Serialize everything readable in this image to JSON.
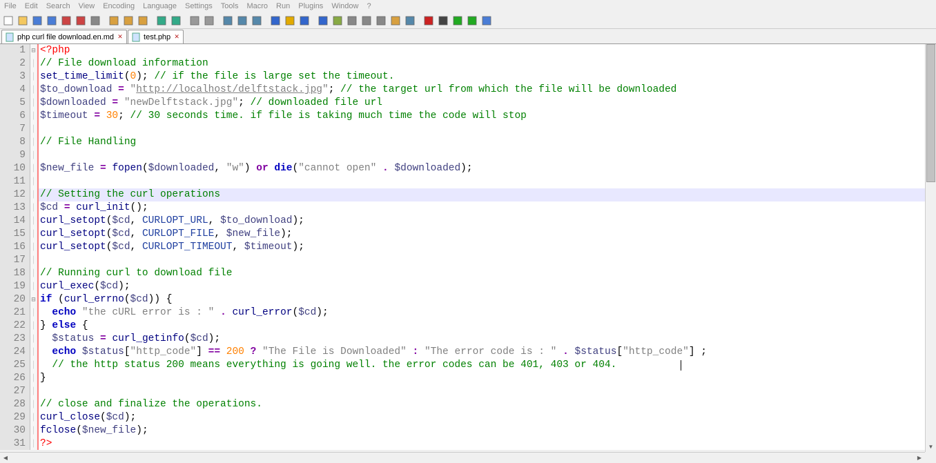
{
  "menu": [
    "File",
    "Edit",
    "Search",
    "View",
    "Encoding",
    "Language",
    "Settings",
    "Tools",
    "Macro",
    "Run",
    "Plugins",
    "Window",
    "?"
  ],
  "toolbar_icons": [
    "new-icon",
    "open-icon",
    "save-icon",
    "saveall-icon",
    "close-icon",
    "closeall-icon",
    "print-icon",
    "",
    "cut-icon",
    "copy-icon",
    "paste-icon",
    "",
    "undo-icon",
    "redo-icon",
    "",
    "find-icon",
    "replace-icon",
    "",
    "zoomin-icon",
    "zoomout-icon",
    "sync-icon",
    "",
    "wordwrap-icon",
    "showall-icon",
    "indent-icon",
    "",
    "foldlevel-icon",
    "userlang-icon",
    "doc-map-icon",
    "doc-list-icon",
    "func-list-icon",
    "folder-icon",
    "monitor-icon",
    "",
    "record-icon",
    "stop-icon",
    "play-icon",
    "playmulti-icon",
    "savemacro-icon"
  ],
  "tabs": [
    {
      "label": "php curl file download.en.md",
      "active": false
    },
    {
      "label": "test.php",
      "active": true
    }
  ],
  "highlight_line": 12,
  "fold_marks": {
    "1": "⊟",
    "20": "⊟"
  },
  "cursor_line": 25,
  "lines": [
    {
      "n": 1,
      "seg": [
        [
          "<?php",
          "c-tag"
        ]
      ]
    },
    {
      "n": 2,
      "seg": [
        [
          "// File download information",
          "c-cmt"
        ]
      ]
    },
    {
      "n": 3,
      "seg": [
        [
          "set_time_limit",
          "c-fn"
        ],
        [
          "(",
          ""
        ],
        [
          "0",
          "c-num"
        ],
        [
          ");",
          ""
        ],
        [
          " ",
          ""
        ],
        [
          "// if the file is large set the timeout.",
          "c-cmt"
        ]
      ]
    },
    {
      "n": 4,
      "seg": [
        [
          "$to_download",
          "c-vr"
        ],
        [
          " ",
          ""
        ],
        [
          "=",
          "c-op"
        ],
        [
          " ",
          ""
        ],
        [
          "\"",
          "c-str"
        ],
        [
          "http://localhost/delftstack.jpg",
          "c-url"
        ],
        [
          "\"",
          "c-str"
        ],
        [
          "; ",
          ""
        ],
        [
          "// the target url from which the file will be downloaded",
          "c-cmt"
        ]
      ]
    },
    {
      "n": 5,
      "seg": [
        [
          "$downloaded",
          "c-vr"
        ],
        [
          " ",
          ""
        ],
        [
          "=",
          "c-op"
        ],
        [
          " ",
          ""
        ],
        [
          "\"newDelftstack.jpg\"",
          "c-str"
        ],
        [
          "; ",
          ""
        ],
        [
          "// downloaded file url",
          "c-cmt"
        ]
      ]
    },
    {
      "n": 6,
      "seg": [
        [
          "$timeout",
          "c-vr"
        ],
        [
          " ",
          ""
        ],
        [
          "=",
          "c-op"
        ],
        [
          " ",
          ""
        ],
        [
          "30",
          "c-num"
        ],
        [
          "; ",
          ""
        ],
        [
          "// 30 seconds time. if file is taking much time the code will stop",
          "c-cmt"
        ]
      ]
    },
    {
      "n": 7,
      "seg": [
        [
          "",
          ""
        ]
      ]
    },
    {
      "n": 8,
      "seg": [
        [
          "// File Handling",
          "c-cmt"
        ]
      ]
    },
    {
      "n": 9,
      "seg": [
        [
          "",
          ""
        ]
      ]
    },
    {
      "n": 10,
      "seg": [
        [
          "$new_file",
          "c-vr"
        ],
        [
          " ",
          ""
        ],
        [
          "=",
          "c-op"
        ],
        [
          " ",
          ""
        ],
        [
          "fopen",
          "c-fn"
        ],
        [
          "(",
          ""
        ],
        [
          "$downloaded",
          "c-vr"
        ],
        [
          ", ",
          ""
        ],
        [
          "\"w\"",
          "c-str"
        ],
        [
          ") ",
          ""
        ],
        [
          "or",
          "c-kw2"
        ],
        [
          " ",
          ""
        ],
        [
          "die",
          "c-kw"
        ],
        [
          "(",
          ""
        ],
        [
          "\"cannot open\"",
          "c-str"
        ],
        [
          " ",
          ""
        ],
        [
          ".",
          "c-op"
        ],
        [
          " ",
          ""
        ],
        [
          "$downloaded",
          "c-vr"
        ],
        [
          ");",
          ""
        ]
      ]
    },
    {
      "n": 11,
      "seg": [
        [
          "",
          ""
        ]
      ]
    },
    {
      "n": 12,
      "seg": [
        [
          "// Setting the curl operations",
          "c-cmt"
        ]
      ]
    },
    {
      "n": 13,
      "seg": [
        [
          "$cd",
          "c-vr"
        ],
        [
          " ",
          ""
        ],
        [
          "=",
          "c-op"
        ],
        [
          " ",
          ""
        ],
        [
          "curl_init",
          "c-fn"
        ],
        [
          "();",
          ""
        ]
      ]
    },
    {
      "n": 14,
      "seg": [
        [
          "curl_setopt",
          "c-fn"
        ],
        [
          "(",
          ""
        ],
        [
          "$cd",
          "c-vr"
        ],
        [
          ", ",
          ""
        ],
        [
          "CURLOPT_URL",
          "c-con"
        ],
        [
          ", ",
          ""
        ],
        [
          "$to_download",
          "c-vr"
        ],
        [
          ");",
          ""
        ]
      ]
    },
    {
      "n": 15,
      "seg": [
        [
          "curl_setopt",
          "c-fn"
        ],
        [
          "(",
          ""
        ],
        [
          "$cd",
          "c-vr"
        ],
        [
          ", ",
          ""
        ],
        [
          "CURLOPT_FILE",
          "c-con"
        ],
        [
          ", ",
          ""
        ],
        [
          "$new_file",
          "c-vr"
        ],
        [
          ");",
          ""
        ]
      ]
    },
    {
      "n": 16,
      "seg": [
        [
          "curl_setopt",
          "c-fn"
        ],
        [
          "(",
          ""
        ],
        [
          "$cd",
          "c-vr"
        ],
        [
          ", ",
          ""
        ],
        [
          "CURLOPT_TIMEOUT",
          "c-con"
        ],
        [
          ", ",
          ""
        ],
        [
          "$timeout",
          "c-vr"
        ],
        [
          ");",
          ""
        ]
      ]
    },
    {
      "n": 17,
      "seg": [
        [
          "",
          ""
        ]
      ]
    },
    {
      "n": 18,
      "seg": [
        [
          "// Running curl to download file",
          "c-cmt"
        ]
      ]
    },
    {
      "n": 19,
      "seg": [
        [
          "curl_exec",
          "c-fn"
        ],
        [
          "(",
          ""
        ],
        [
          "$cd",
          "c-vr"
        ],
        [
          ");",
          ""
        ]
      ]
    },
    {
      "n": 20,
      "seg": [
        [
          "if",
          "c-kw"
        ],
        [
          " (",
          ""
        ],
        [
          "curl_errno",
          "c-fn"
        ],
        [
          "(",
          ""
        ],
        [
          "$cd",
          "c-vr"
        ],
        [
          ")) {",
          ""
        ]
      ]
    },
    {
      "n": 21,
      "seg": [
        [
          "  ",
          ""
        ],
        [
          "echo",
          "c-kw"
        ],
        [
          " ",
          ""
        ],
        [
          "\"the cURL error is : \"",
          "c-str"
        ],
        [
          " ",
          ""
        ],
        [
          ".",
          "c-op"
        ],
        [
          " ",
          ""
        ],
        [
          "curl_error",
          "c-fn"
        ],
        [
          "(",
          ""
        ],
        [
          "$cd",
          "c-vr"
        ],
        [
          ");",
          ""
        ]
      ]
    },
    {
      "n": 22,
      "seg": [
        [
          "} ",
          ""
        ],
        [
          "else",
          "c-kw"
        ],
        [
          " {",
          ""
        ]
      ]
    },
    {
      "n": 23,
      "seg": [
        [
          "  ",
          ""
        ],
        [
          "$status",
          "c-vr"
        ],
        [
          " ",
          ""
        ],
        [
          "=",
          "c-op"
        ],
        [
          " ",
          ""
        ],
        [
          "curl_getinfo",
          "c-fn"
        ],
        [
          "(",
          ""
        ],
        [
          "$cd",
          "c-vr"
        ],
        [
          ");",
          ""
        ]
      ]
    },
    {
      "n": 24,
      "seg": [
        [
          "  ",
          ""
        ],
        [
          "echo",
          "c-kw"
        ],
        [
          " ",
          ""
        ],
        [
          "$status",
          "c-vr"
        ],
        [
          "[",
          ""
        ],
        [
          "\"http_code\"",
          "c-str"
        ],
        [
          "] ",
          ""
        ],
        [
          "==",
          "c-op"
        ],
        [
          " ",
          ""
        ],
        [
          "200",
          "c-num"
        ],
        [
          " ",
          ""
        ],
        [
          "?",
          "c-op"
        ],
        [
          " ",
          ""
        ],
        [
          "\"The File is Downloaded\"",
          "c-str"
        ],
        [
          " ",
          ""
        ],
        [
          ":",
          "c-op"
        ],
        [
          " ",
          ""
        ],
        [
          "\"The error code is : \"",
          "c-str"
        ],
        [
          " ",
          ""
        ],
        [
          ".",
          "c-op"
        ],
        [
          " ",
          ""
        ],
        [
          "$status",
          "c-vr"
        ],
        [
          "[",
          ""
        ],
        [
          "\"http_code\"",
          "c-str"
        ],
        [
          "] ;",
          ""
        ]
      ]
    },
    {
      "n": 25,
      "seg": [
        [
          "  ",
          ""
        ],
        [
          "// the http status 200 means everything is going well. the error codes can be 401, 403 or 404.",
          "c-cmt"
        ]
      ]
    },
    {
      "n": 26,
      "seg": [
        [
          "}",
          ""
        ]
      ]
    },
    {
      "n": 27,
      "seg": [
        [
          "",
          ""
        ]
      ]
    },
    {
      "n": 28,
      "seg": [
        [
          "// close and finalize the operations.",
          "c-cmt"
        ]
      ]
    },
    {
      "n": 29,
      "seg": [
        [
          "curl_close",
          "c-fn"
        ],
        [
          "(",
          ""
        ],
        [
          "$cd",
          "c-vr"
        ],
        [
          ");",
          ""
        ]
      ]
    },
    {
      "n": 30,
      "seg": [
        [
          "fclose",
          "c-fn"
        ],
        [
          "(",
          ""
        ],
        [
          "$new_file",
          "c-vr"
        ],
        [
          ");",
          ""
        ]
      ]
    },
    {
      "n": 31,
      "seg": [
        [
          "?>",
          "c-tag"
        ]
      ]
    }
  ]
}
